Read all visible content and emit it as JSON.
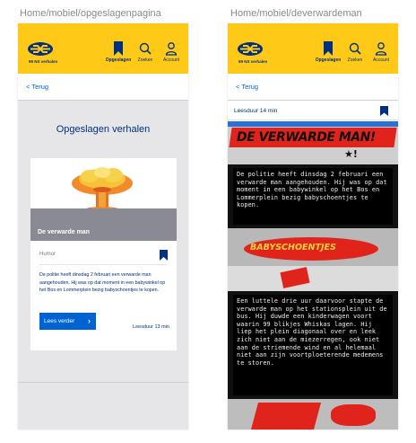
{
  "frames": [
    {
      "label": "Home/mobiel/opgeslagenpagina"
    },
    {
      "label": "Home/mobiel/deverwardeman"
    }
  ],
  "logo": {
    "subtitle": "99 NS verhalen"
  },
  "nav": {
    "saved": "Opgeslagen",
    "search": "Zoeken",
    "account": "Account"
  },
  "back_label": "< Terug",
  "saved_page": {
    "title": "Opgeslagen verhalen",
    "card": {
      "title": "De verwarde man",
      "genre": "Humor",
      "text": "De politie heeft dinsdag 2 februari een verwarde man aangehouden. Hij was op dat moment in een babywinkel op het Bos en Lommerplein bezig babyschoentjes te kopen.",
      "button": "Lees verder",
      "duration": "Leesduur 13 min"
    }
  },
  "story_page": {
    "duration": "Leesduur 14 min",
    "comic_title": "DE VERWARDE MAN!",
    "comic_sub": "BABYSCHOENTJES",
    "paragraph1": "De politie heeft dinsdag 2 februari een verwarde man aangehouden. Hij was op dat moment in een babywinkel op het Bos en Lommerplein bezig babyschoentjes te kopen.",
    "paragraph2": "Een luttele drie uur daarvoor stapte de verwarde man op het stationsplein uit de bus. Hij duwde een kinderwagen voort waarin 99 blikjes Whiskas lagen. Hij liep het plein diagonaal over en leek zich niet aan de miezerregen, ook niet aan de striemende wind en al helemaal niet aan zijn voortploeterende medemens te storen."
  },
  "colors": {
    "brand_yellow": "#ffc917",
    "brand_blue": "#003082",
    "accent_blue": "#0063d3",
    "comic_red": "#e0241b"
  }
}
